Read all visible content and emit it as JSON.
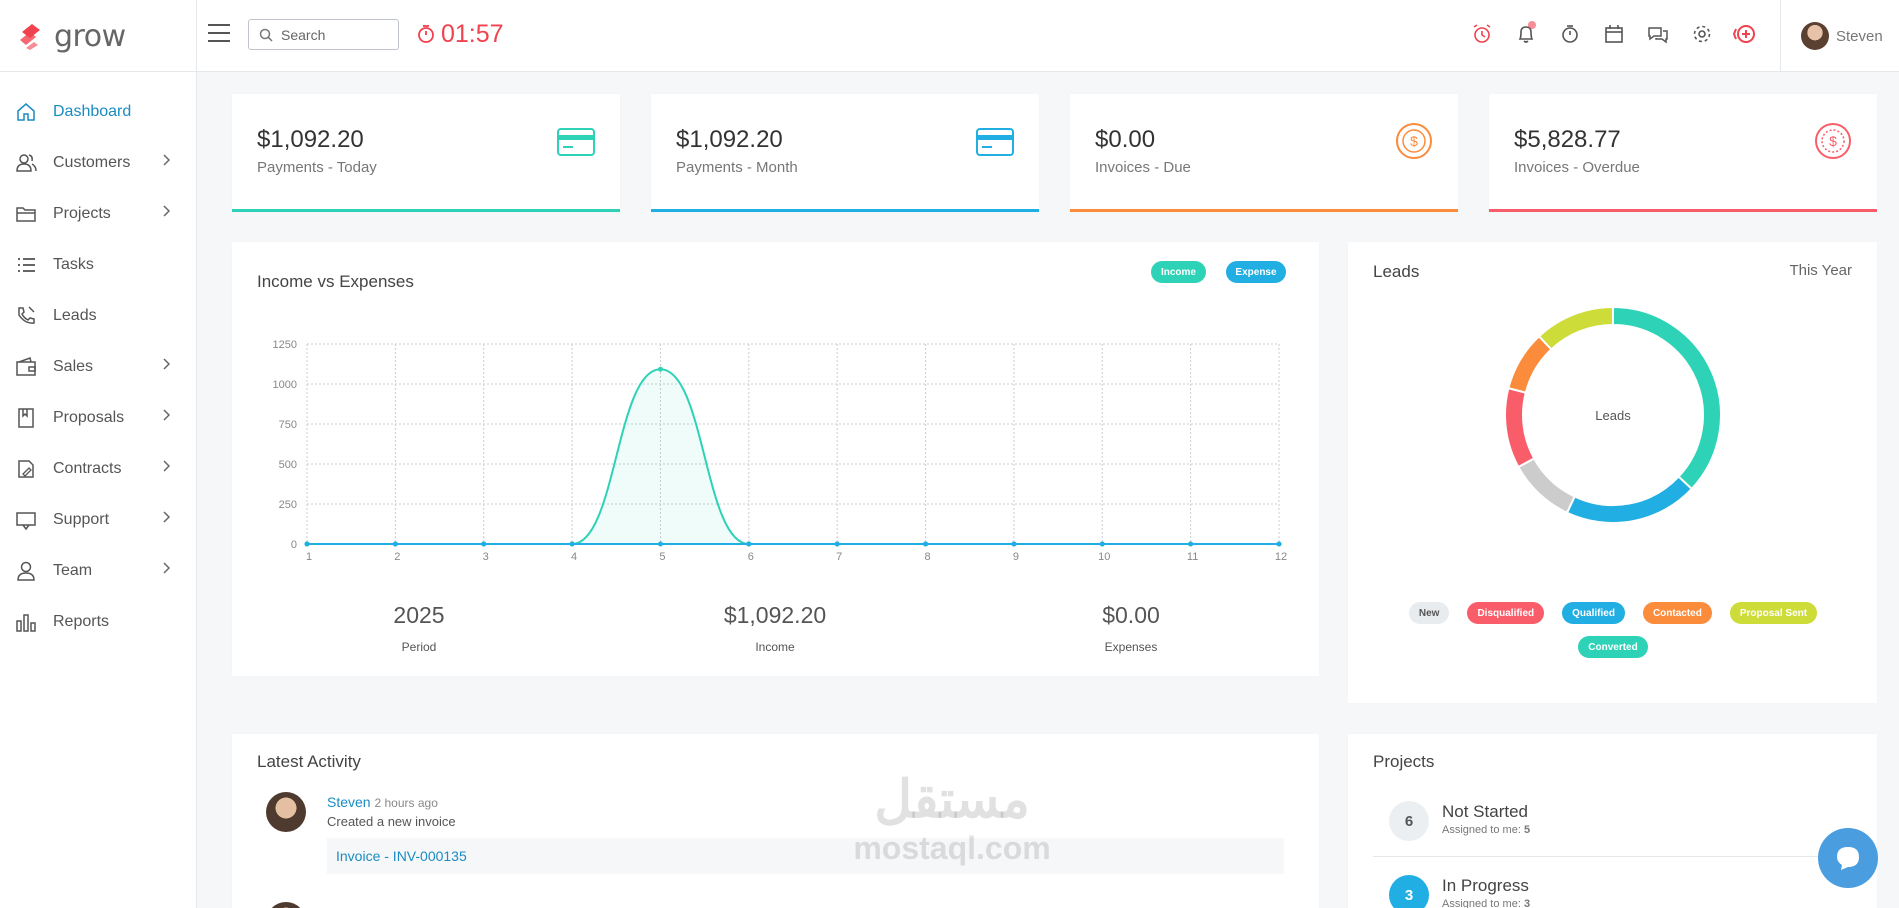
{
  "app": {
    "logo_text": "grow"
  },
  "topbar": {
    "search_placeholder": "Search",
    "timer": "01:57",
    "user_name": "Steven",
    "icons": [
      "alarm-clock-icon",
      "bell-icon",
      "stopwatch-icon",
      "calendar-icon",
      "chat-icon",
      "gear-icon",
      "plus-circle-icon"
    ]
  },
  "sidebar": {
    "items": [
      {
        "label": "Dashboard",
        "icon": "home-icon",
        "active": true,
        "has_submenu": false
      },
      {
        "label": "Customers",
        "icon": "users-icon",
        "has_submenu": true
      },
      {
        "label": "Projects",
        "icon": "folder-icon",
        "has_submenu": true
      },
      {
        "label": "Tasks",
        "icon": "list-icon",
        "has_submenu": false
      },
      {
        "label": "Leads",
        "icon": "phone-icon",
        "has_submenu": false
      },
      {
        "label": "Sales",
        "icon": "wallet-icon",
        "has_submenu": true
      },
      {
        "label": "Proposals",
        "icon": "book-icon",
        "has_submenu": true
      },
      {
        "label": "Contracts",
        "icon": "file-pen-icon",
        "has_submenu": true
      },
      {
        "label": "Support",
        "icon": "support-icon",
        "has_submenu": true
      },
      {
        "label": "Team",
        "icon": "user-icon",
        "has_submenu": true
      },
      {
        "label": "Reports",
        "icon": "bar-chart-icon",
        "has_submenu": false
      }
    ]
  },
  "stats": [
    {
      "amount": "$1,092.20",
      "label": "Payments - Today",
      "color": "#2ed3b7",
      "icon": "credit-card-icon"
    },
    {
      "amount": "$1,092.20",
      "label": "Payments - Month",
      "color": "#20aee3",
      "icon": "credit-card-icon"
    },
    {
      "amount": "$0.00",
      "label": "Invoices - Due",
      "color": "#fb8c3c",
      "icon": "dollar-circle-icon"
    },
    {
      "amount": "$5,828.77",
      "label": "Invoices - Overdue",
      "color": "#f95d6a",
      "icon": "dollar-circle-icon"
    }
  ],
  "income_chart": {
    "title": "Income vs Expenses",
    "legend": [
      {
        "label": "Income",
        "color": "#2ed3b7"
      },
      {
        "label": "Expense",
        "color": "#20aee3"
      }
    ],
    "summary": [
      {
        "value": "2025",
        "label": "Period"
      },
      {
        "value": "$1,092.20",
        "label": "Income"
      },
      {
        "value": "$0.00",
        "label": "Expenses"
      }
    ]
  },
  "leads": {
    "title": "Leads",
    "filter": "This Year",
    "center_label": "Leads",
    "legend": [
      {
        "label": "New",
        "color": "#e9ecef",
        "text_color": "#555"
      },
      {
        "label": "Disqualified",
        "color": "#f95d6a",
        "text_color": "#fff"
      },
      {
        "label": "Qualified",
        "color": "#20aee3",
        "text_color": "#fff"
      },
      {
        "label": "Contacted",
        "color": "#fb8c3c",
        "text_color": "#fff"
      },
      {
        "label": "Proposal Sent",
        "color": "#cddc39",
        "text_color": "#fff"
      },
      {
        "label": "Converted",
        "color": "#2ed3b7",
        "text_color": "#fff"
      }
    ]
  },
  "activity": {
    "title": "Latest Activity",
    "items": [
      {
        "user": "Steven",
        "time": "2 hours ago",
        "action": "Created a new invoice",
        "link": "Invoice - INV-000135"
      }
    ]
  },
  "projects": {
    "title": "Projects",
    "items": [
      {
        "count": "6",
        "label": "Not Started",
        "assigned_label": "Assigned to me:",
        "assigned": "5",
        "bg": "#eceff1",
        "fg": "#555"
      },
      {
        "count": "3",
        "label": "In Progress",
        "assigned_label": "Assigned to me:",
        "assigned": "3",
        "bg": "#20aee3",
        "fg": "#fff"
      }
    ]
  },
  "watermark": {
    "arabic": "مستقل",
    "latin": "mostaql.com"
  },
  "chart_data": [
    {
      "type": "area",
      "title": "Income vs Expenses",
      "x": [
        1,
        2,
        3,
        4,
        5,
        6,
        7,
        8,
        9,
        10,
        11,
        12
      ],
      "ylim": [
        0,
        1250
      ],
      "yticks": [
        0,
        250,
        500,
        750,
        1000,
        1250
      ],
      "grid": true,
      "legend": "top-right",
      "series": [
        {
          "name": "Income",
          "color": "#2ed3b7",
          "values": [
            0,
            0,
            0,
            0,
            1092.2,
            0,
            0,
            0,
            0,
            0,
            0,
            0
          ]
        },
        {
          "name": "Expense",
          "color": "#20aee3",
          "values": [
            0,
            0,
            0,
            0,
            0,
            0,
            0,
            0,
            0,
            0,
            0,
            0
          ]
        }
      ]
    },
    {
      "type": "pie",
      "title": "Leads",
      "categories": [
        "Converted",
        "Qualified",
        "New",
        "Disqualified",
        "Contacted",
        "Proposal Sent"
      ],
      "values": [
        37,
        20,
        10,
        12,
        9,
        12
      ],
      "colors": [
        "#2ed3b7",
        "#20aee3",
        "#cccccc",
        "#f95d6a",
        "#fb8c3c",
        "#cddc39"
      ],
      "legend": "bottom"
    }
  ]
}
